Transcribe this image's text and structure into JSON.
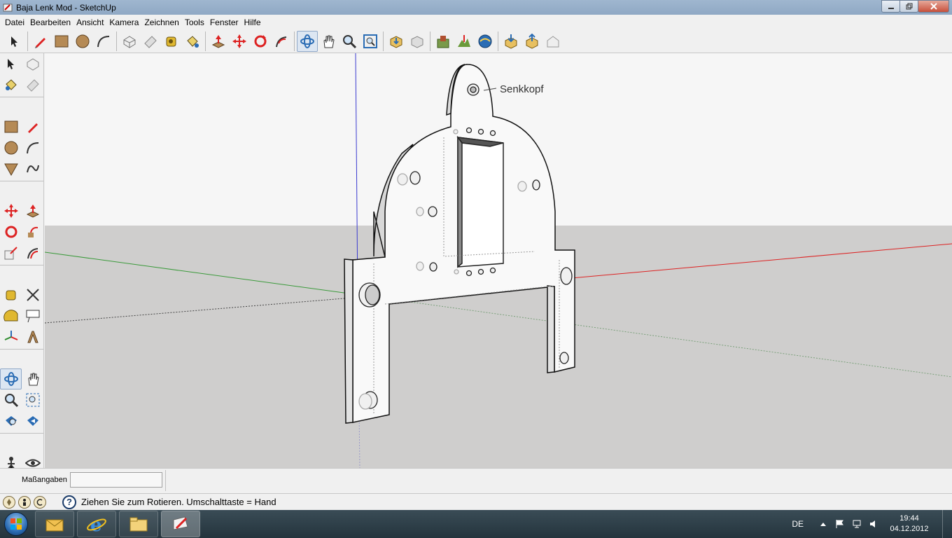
{
  "window": {
    "title": "Baja Lenk Mod - SketchUp",
    "buttons": [
      "minimize",
      "maximize",
      "close"
    ]
  },
  "menu": {
    "items": [
      "Datei",
      "Bearbeiten",
      "Ansicht",
      "Kamera",
      "Zeichnen",
      "Tools",
      "Fenster",
      "Hilfe"
    ]
  },
  "top_toolbar": {
    "tools": [
      "select-icon",
      "pencil-icon",
      "rectangle-icon",
      "circle-icon",
      "arc-icon",
      "make-component-icon",
      "eraser-icon",
      "tape-measure-icon",
      "paint-bucket-icon",
      "push-pull-icon",
      "move-icon",
      "rotate-icon",
      "follow-me-icon",
      "orbit-icon",
      "pan-icon",
      "zoom-icon",
      "zoom-extents-icon",
      "previous-view-icon",
      "next-view-icon",
      "get-models-icon",
      "share-model-icon",
      "google-earth-icon",
      "import-icon",
      "export-icon",
      "warehouse-icon"
    ],
    "active": "orbit-icon"
  },
  "left_toolbar": {
    "tools": [
      "select-icon",
      "make-component-icon",
      "paint-bucket-icon",
      "eraser-icon",
      "rectangle-icon",
      "line-icon",
      "circle-icon",
      "arc-icon",
      "polygon-icon",
      "freehand-icon",
      "move-icon",
      "push-pull-icon",
      "rotate-icon",
      "follow-me-icon",
      "scale-icon",
      "offset-icon",
      "tape-measure-icon",
      "dimension-icon",
      "protractor-icon",
      "text-icon",
      "axes-icon",
      "3d-text-icon",
      "orbit-icon",
      "pan-icon",
      "zoom-icon",
      "zoom-window-icon",
      "zoom-extents-icon",
      "previous-icon",
      "walk-icon",
      "look-around-icon",
      "footprints-icon",
      "position-camera-icon"
    ],
    "active": "orbit-icon"
  },
  "viewport": {
    "annotation": "Senkkopf"
  },
  "measurements": {
    "label": "Maßangaben",
    "value": ""
  },
  "status": {
    "text": "Ziehen Sie zum Rotieren.  Umschalttaste = Hand"
  },
  "taskbar": {
    "apps": [
      "outlook-icon",
      "internet-explorer-icon",
      "explorer-folder-icon",
      "sketchup-icon"
    ],
    "active_app": "sketchup-icon",
    "language": "DE",
    "time": "19:44",
    "date": "04.12.2012"
  }
}
